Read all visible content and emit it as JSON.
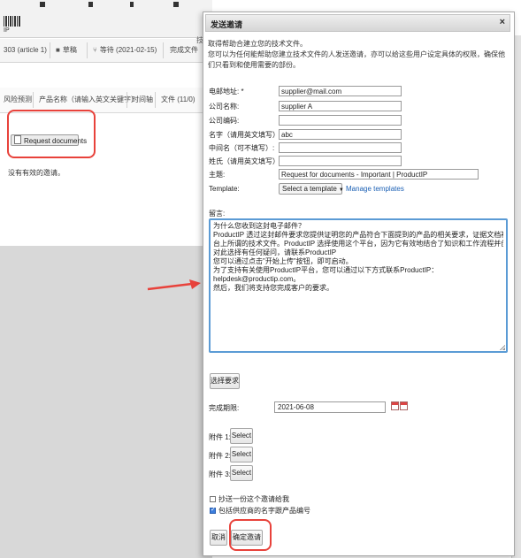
{
  "background": {
    "logo_text": "IP",
    "tabs": [
      {
        "label": "303 (article 1)"
      },
      {
        "icon": "folder-icon",
        "label": "草稿"
      },
      {
        "icon": "workflow-icon",
        "label": "等待 (2021-02-15)"
      },
      {
        "label": "完成文件"
      }
    ],
    "chrome_text": "技",
    "subtabs": [
      "风险预测",
      "产品名称（请输入英文关键字）",
      "时间轴",
      "文件 (11/0)"
    ],
    "request_button_label": "Request documents",
    "no_invites_text": "没有有效的邀请。"
  },
  "dialog": {
    "title": "发送邀请",
    "close_label": "×",
    "intro_line1": "取得帮助合建立您的技术文件。",
    "intro_line2": "您可以为任何能帮助您建立技术文件的人发送邀请，亦可以给这些用户设定具体的权限，确保他们只看到和使用需要的部份。",
    "fields": {
      "email": {
        "label": "电邮地址: *",
        "value": "supplier@mail.com"
      },
      "company_name": {
        "label": "公司名称:",
        "value": "supplier A"
      },
      "company_code": {
        "label": "公司编码:",
        "value": ""
      },
      "first_name": {
        "label": "名字（请用英文填写）: *",
        "value": "abc"
      },
      "middle_name": {
        "label": "中间名（可不填写）:",
        "value": ""
      },
      "last_name": {
        "label": "姓氏（请用英文填写）:",
        "value": ""
      },
      "subject": {
        "label": "主题:",
        "value": "Request for documents - Important | ProductIP"
      },
      "template": {
        "label": "Template:",
        "selected": "Select a template"
      }
    },
    "manage_templates_label": "Manage templates",
    "message_label": "留言:",
    "message_lines": [
      "为什么您收到这封电子邮件？",
      "ProductIP 透过这封邮件要求您提供证明您的产品符合下面提到的产品的相关要求，证据文档被收集在ProductIP平",
      "台上所谓的技术文件。ProductIP 选择使用这个平台，因为它有效地结合了知识和工作流程并创建技术文件，如果您",
      "对此选择有任何疑问，请联系ProductIP",
      "您可以通过点击\"开始上传\"按钮，即可启动。",
      "为了支持有关使用ProductIP平台，您可以通过以下方式联系ProductIP：",
      "helpdesk@productip.com。",
      "然后，我们将支持您完成客户的要求。"
    ],
    "select_requirements_label": "选择要求",
    "deadline_label": "完成期限:",
    "deadline_value": "2021-06-08",
    "attachments": [
      {
        "label": "附件 1:",
        "button": "Select"
      },
      {
        "label": "附件 2:",
        "button": "Select"
      },
      {
        "label": "附件 3:",
        "button": "Select"
      }
    ],
    "checkboxes": [
      {
        "label": "抄送一份这个邀请给我",
        "checked": false
      },
      {
        "label": "包括供应商的名字跟产品编号",
        "checked": true
      }
    ],
    "cancel_label": "取消",
    "confirm_label": "确定邀请"
  },
  "colors": {
    "highlight_red": "#e8423b",
    "textarea_border": "#5b9bd5",
    "link_blue": "#1a5fb4"
  }
}
